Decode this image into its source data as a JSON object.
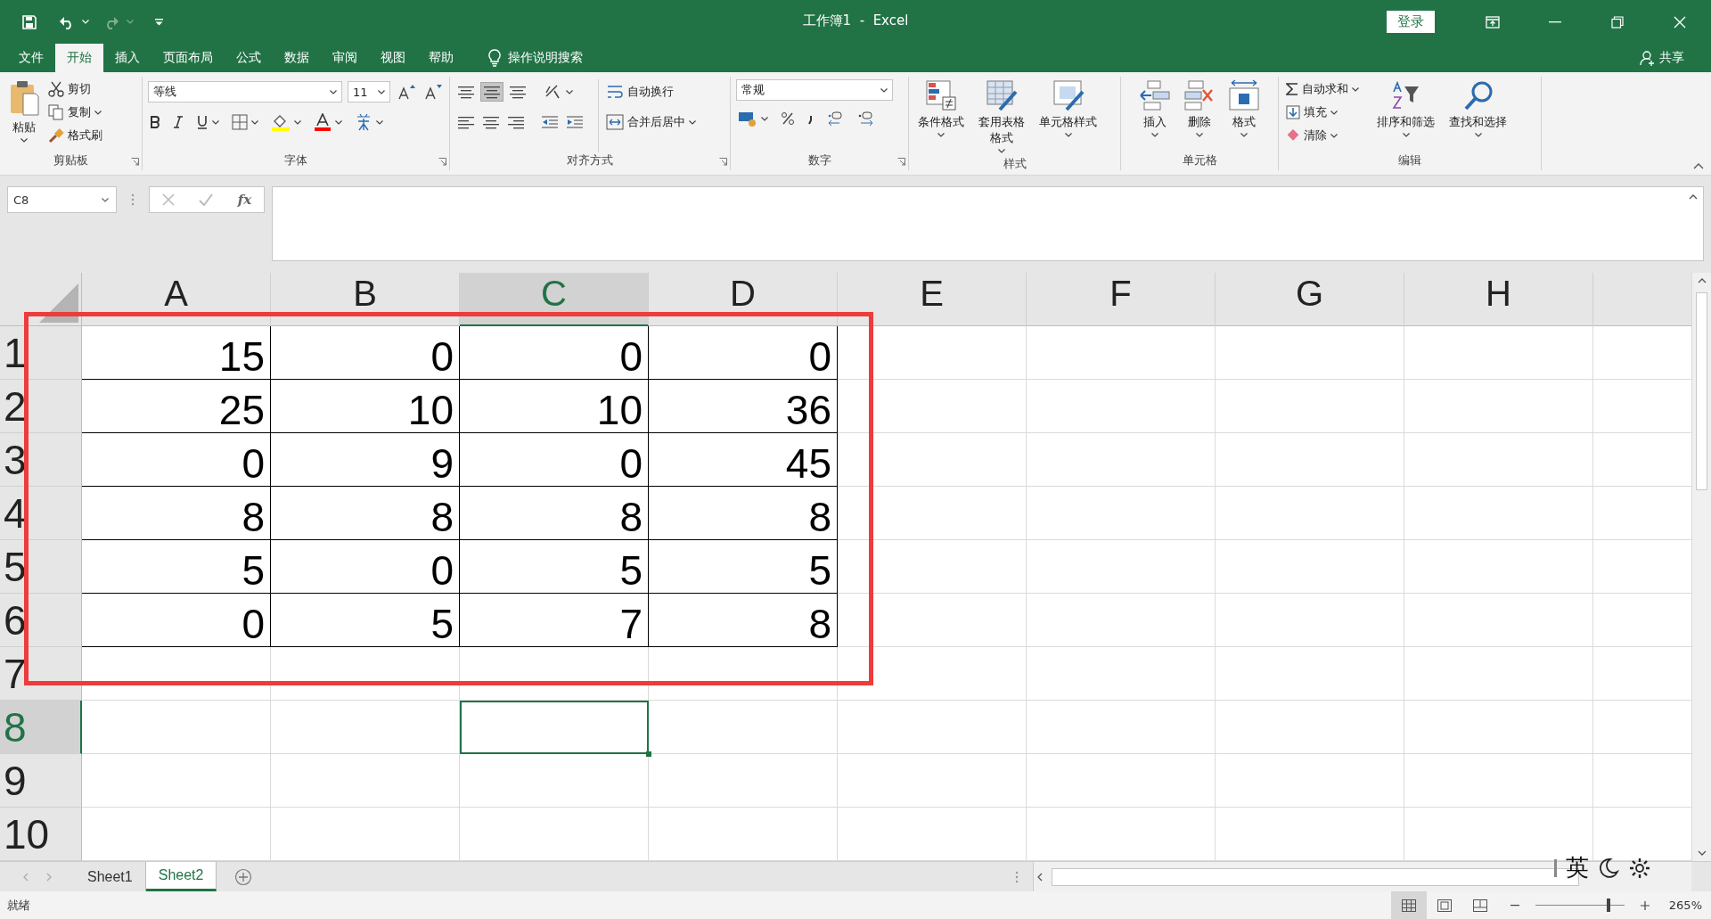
{
  "title_bar": {
    "title": "工作簿1  -  Excel",
    "sign_in": "登录"
  },
  "menu": {
    "tabs": [
      {
        "label": "文件",
        "selected": false
      },
      {
        "label": "开始",
        "selected": true
      },
      {
        "label": "插入",
        "selected": false
      },
      {
        "label": "页面布局",
        "selected": false
      },
      {
        "label": "公式",
        "selected": false
      },
      {
        "label": "数据",
        "selected": false
      },
      {
        "label": "审阅",
        "selected": false
      },
      {
        "label": "视图",
        "selected": false
      },
      {
        "label": "帮助",
        "selected": false
      }
    ],
    "tell_me": "操作说明搜索",
    "share": "共享"
  },
  "ribbon": {
    "clipboard": {
      "paste": "粘贴",
      "cut": "剪切",
      "copy": "复制",
      "format_painter": "格式刷",
      "label": "剪贴板"
    },
    "font": {
      "name": "等线",
      "size": "11",
      "label": "字体"
    },
    "alignment": {
      "wrap": "自动换行",
      "merge": "合并后居中",
      "label": "对齐方式"
    },
    "number": {
      "format": "常规",
      "label": "数字"
    },
    "styles": {
      "buttons": [
        "条件格式",
        "套用表格格式",
        "单元格样式"
      ],
      "label": "样式"
    },
    "cells": {
      "buttons": [
        "插入",
        "删除",
        "格式"
      ],
      "label": "单元格"
    },
    "editing": {
      "autosum": "自动求和",
      "fill": "填充",
      "clear": "清除",
      "sort": "排序和筛选",
      "find": "查找和选择",
      "label": "编辑"
    }
  },
  "formula_bar": {
    "name_box": "C8",
    "function_label": "fx"
  },
  "sheet": {
    "columns": [
      {
        "label": "A",
        "selected": false
      },
      {
        "label": "B",
        "selected": false
      },
      {
        "label": "C",
        "selected": true
      },
      {
        "label": "D",
        "selected": false
      },
      {
        "label": "E",
        "selected": false
      },
      {
        "label": "F",
        "selected": false
      },
      {
        "label": "G",
        "selected": false
      },
      {
        "label": "H",
        "selected": false
      }
    ],
    "rows": [
      {
        "label": "1",
        "selected": false,
        "cells": [
          "15",
          "0",
          "0",
          "0"
        ]
      },
      {
        "label": "2",
        "selected": false,
        "cells": [
          "25",
          "10",
          "10",
          "36"
        ]
      },
      {
        "label": "3",
        "selected": false,
        "cells": [
          "0",
          "9",
          "0",
          "45"
        ]
      },
      {
        "label": "4",
        "selected": false,
        "cells": [
          "8",
          "8",
          "8",
          "8"
        ]
      },
      {
        "label": "5",
        "selected": false,
        "cells": [
          "5",
          "0",
          "5",
          "5"
        ]
      },
      {
        "label": "6",
        "selected": false,
        "cells": [
          "0",
          "5",
          "7",
          "8"
        ]
      },
      {
        "label": "7",
        "selected": false
      },
      {
        "label": "8",
        "selected": true
      },
      {
        "label": "9",
        "selected": false
      },
      {
        "label": "10",
        "selected": false
      }
    ]
  },
  "sheet_tabs": [
    {
      "label": "Sheet1",
      "selected": false
    },
    {
      "label": "Sheet2",
      "selected": true
    }
  ],
  "ime": {
    "mode": "英"
  },
  "status_bar": {
    "text": "就绪",
    "zoom": "265%",
    "zoom_slider": {
      "level": 0.82
    }
  }
}
